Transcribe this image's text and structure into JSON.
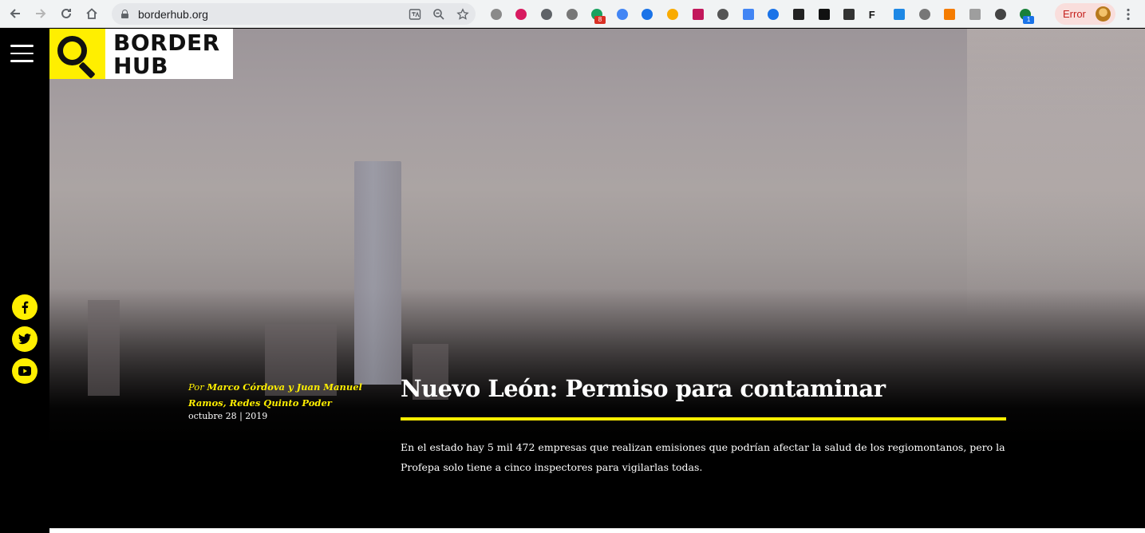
{
  "browser": {
    "url": "borderhub.org",
    "error_label": "Error",
    "extensions": [
      {
        "name": "eyedropper-ext-icon",
        "color": "#8a8a8a",
        "shape": "round"
      },
      {
        "name": "m-ext-icon",
        "color": "#d81b60",
        "shape": "round"
      },
      {
        "name": "circle-ext-icon",
        "color": "#5f6368",
        "shape": "round"
      },
      {
        "name": "gear-swirl-ext-icon",
        "color": "#777777",
        "shape": "round"
      },
      {
        "name": "a-ext-icon",
        "color": "#1aa260",
        "shape": "round",
        "badge": "8",
        "badge_color": "#d93025"
      },
      {
        "name": "feather-ext-icon",
        "color": "#4285f4",
        "shape": "round"
      },
      {
        "name": "graduation-cap-ext-icon",
        "color": "#1a73e8",
        "shape": "round"
      },
      {
        "name": "sun-ext-icon",
        "color": "#f9ab00",
        "shape": "round"
      },
      {
        "name": "card-ext-icon",
        "color": "#c2185b",
        "shape": "square"
      },
      {
        "name": "zero-ext-icon",
        "color": "#555555",
        "shape": "round"
      },
      {
        "name": "translate-ext-icon",
        "color": "#4285f4",
        "shape": "square"
      },
      {
        "name": "eye-ext-icon",
        "color": "#1a73e8",
        "shape": "round"
      },
      {
        "name": "camera-ext-icon",
        "color": "#222222",
        "shape": "square"
      },
      {
        "name": "columns-ext-icon",
        "color": "#111111",
        "shape": "square"
      },
      {
        "name": "invid-ext-icon",
        "color": "#333333",
        "shape": "square"
      },
      {
        "name": "f-ext-icon",
        "color": "#111111",
        "shape": "text",
        "text": "F"
      },
      {
        "name": "window-ext-icon",
        "color": "#1e88e5",
        "shape": "square"
      },
      {
        "name": "settings-ext-icon",
        "color": "#777777",
        "shape": "round"
      },
      {
        "name": "search-orange-ext-icon",
        "color": "#f57c00",
        "shape": "square"
      },
      {
        "name": "camera-gray-ext-icon",
        "color": "#9e9e9e",
        "shape": "square"
      },
      {
        "name": "pin-ext-icon",
        "color": "#444444",
        "shape": "round"
      },
      {
        "name": "green-dot-ext-icon",
        "color": "#188038",
        "shape": "round",
        "badge": "1",
        "badge_color": "#1a73e8"
      }
    ]
  },
  "site": {
    "logo_line1": "BORDER",
    "logo_line2": "HUB"
  },
  "article": {
    "by_prefix": "Por",
    "authors": "Marco Córdova y Juan Manuel Ramos, Redes Quinto Poder",
    "date": "octubre 28 | 2019",
    "title": "Nuevo León: Permiso para contaminar",
    "summary": "En el estado hay 5 mil 472 empresas que realizan emisiones que podrían afectar la salud de los regiomontanos, pero la Profepa solo tiene a cinco inspectores para vigilarlas todas."
  },
  "social": [
    {
      "name": "facebook-icon",
      "glyph": "f"
    },
    {
      "name": "twitter-icon",
      "glyph": ""
    },
    {
      "name": "youtube-icon",
      "glyph": ""
    }
  ]
}
